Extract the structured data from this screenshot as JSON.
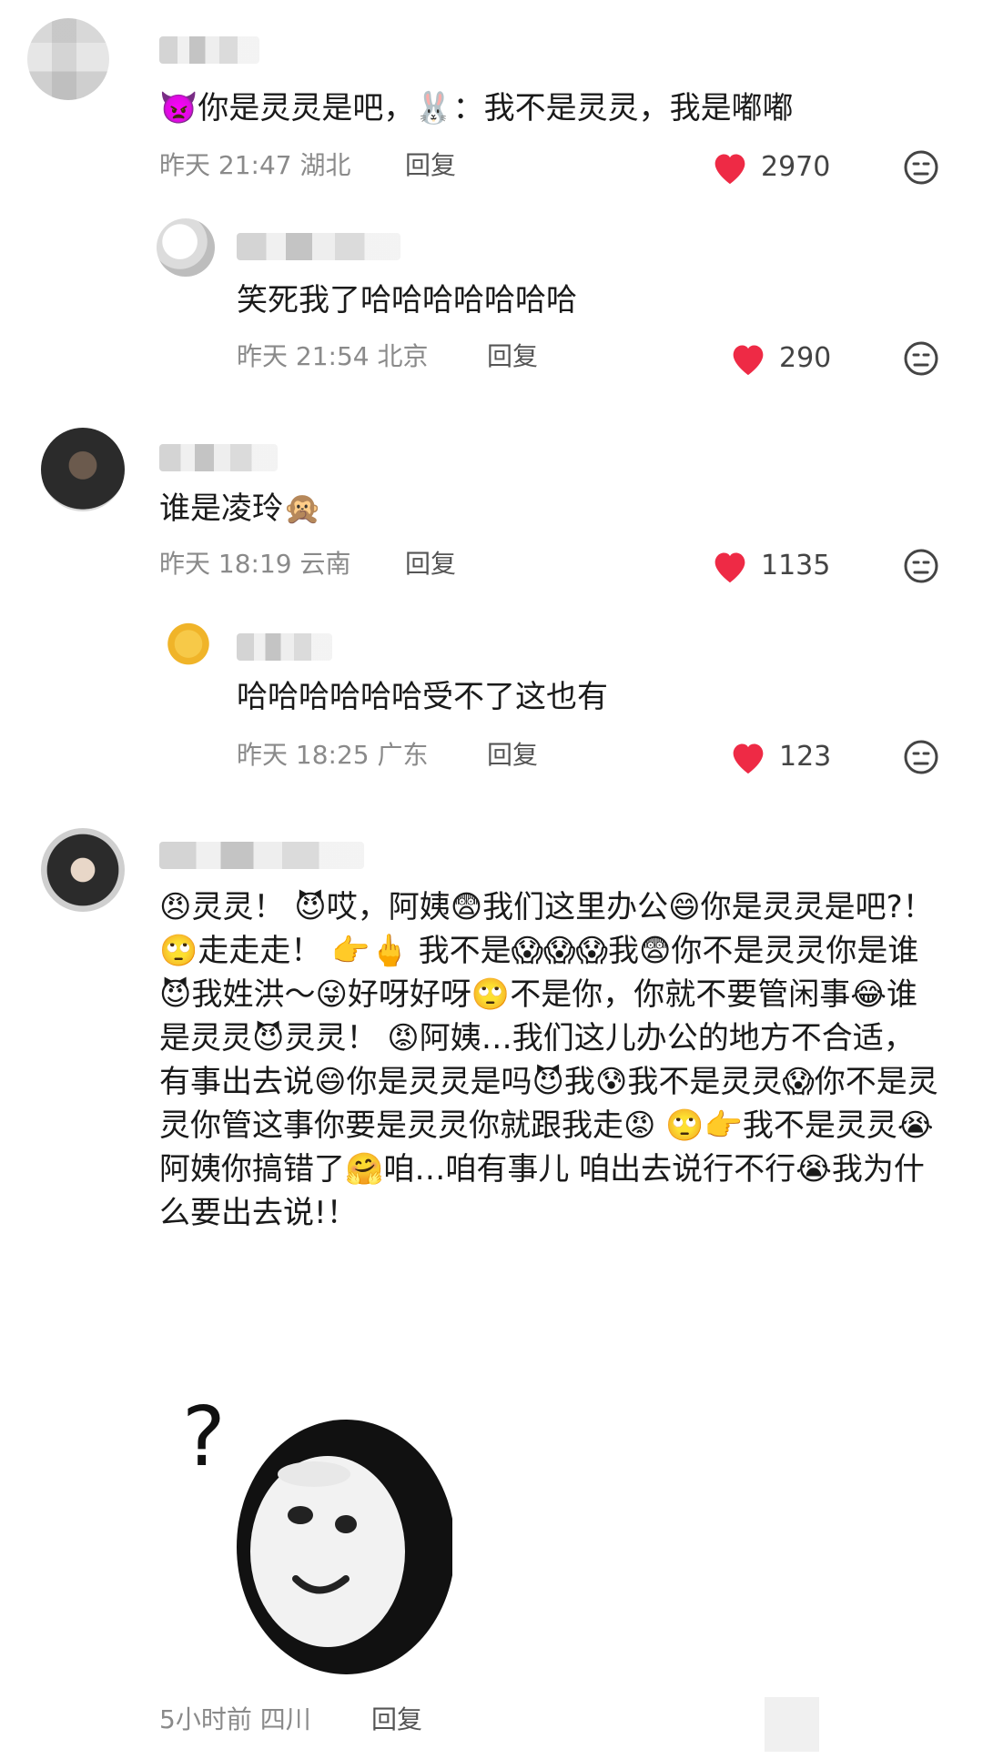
{
  "comments": [
    {
      "text": "👿你是灵灵是吧，🐰：我不是灵灵，我是嘟嘟",
      "meta": "昨天 21:47 湖北",
      "reply_label": "回复",
      "likes": "2970"
    },
    {
      "text": "笑死我了哈哈哈哈哈哈哈",
      "meta": "昨天 21:54 北京",
      "reply_label": "回复",
      "likes": "290"
    },
    {
      "text": "谁是凌玲🙊",
      "meta": "昨天 18:19 云南",
      "reply_label": "回复",
      "likes": "1135"
    },
    {
      "text": "哈哈哈哈哈哈受不了这也有",
      "meta": "昨天 18:25 广东",
      "reply_label": "回复",
      "likes": "123"
    },
    {
      "text": "😠灵灵！ 😈哎，阿姨😨我们这里办公😄你是灵灵是吧?！ 🙄走走走！ 👉🖕 我不是😱😱😱我😨你不是灵灵你是谁😈我姓洪～😜好呀好呀🙄不是你，你就不要管闲事😂谁是灵灵😈灵灵！ 😡阿姨…我们这儿办公的地方不合适，有事出去说😄你是灵灵是吗😈我😰我不是灵灵😱你不是灵灵你管这事你要是灵灵你就跟我走😡 🙄👉我不是灵灵😭阿姨你搞错了🤗咱…咱有事儿 咱出去说行不行😭我为什么要出去说!！",
      "meta": "5小时前 四川",
      "reply_label": "回复"
    }
  ],
  "icons": {
    "like": "heart-icon",
    "dislike": "dislike-face-icon"
  },
  "colors": {
    "heart": "#ee2a45",
    "meta": "#8a8a8a"
  }
}
